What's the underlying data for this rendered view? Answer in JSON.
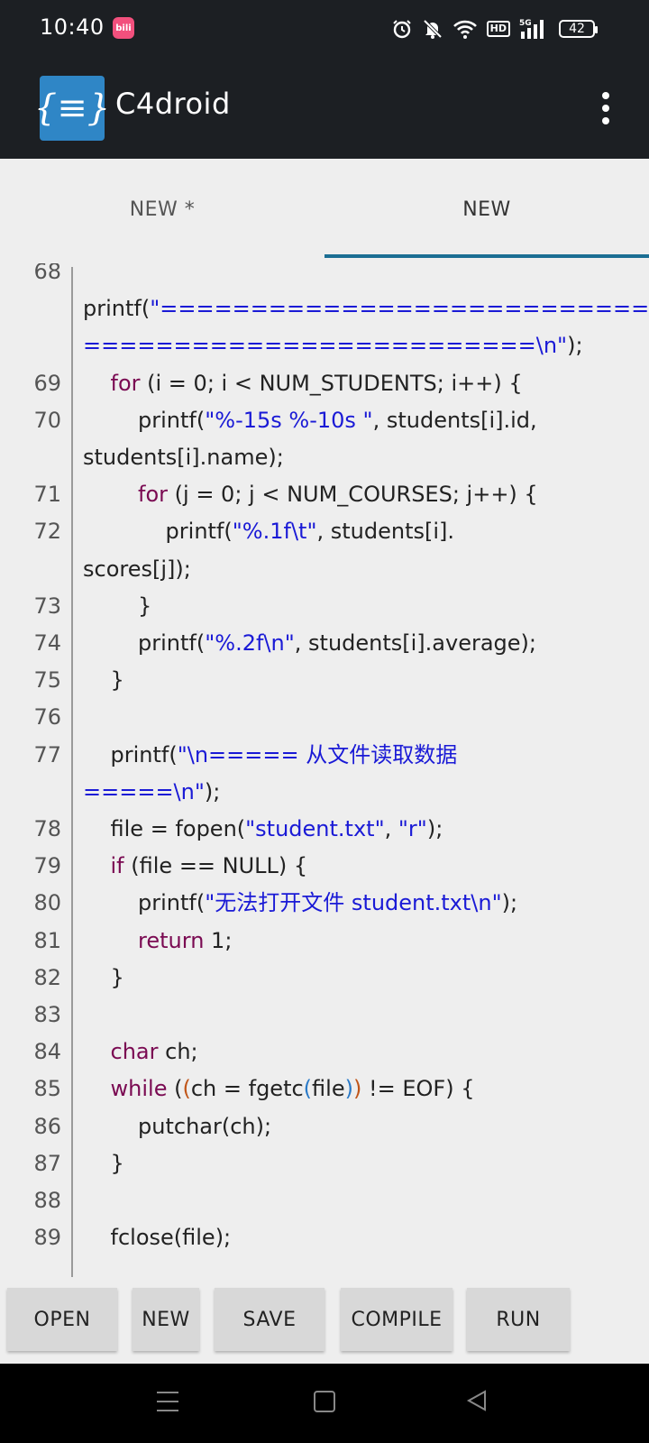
{
  "status_bar": {
    "time": "10:40",
    "app_notification": "bili",
    "battery": "42",
    "network_badge": "HD",
    "network_type": "5G"
  },
  "app_bar": {
    "title": "C4droid",
    "logo_glyph": "{≡}"
  },
  "tabs": [
    {
      "label": "NEW *",
      "active": false
    },
    {
      "label": "NEW",
      "active": true
    }
  ],
  "code_lines": [
    {
      "num": "68",
      "segments": []
    },
    {
      "num": "",
      "segments": [
        {
          "t": "printf(",
          "c": ""
        },
        {
          "t": "\"============================",
          "c": "st"
        }
      ]
    },
    {
      "num": "",
      "segments": [
        {
          "t": "=========================\\n\"",
          "c": "st"
        },
        {
          "t": ");",
          "c": ""
        }
      ]
    },
    {
      "num": "69",
      "segments": [
        {
          "t": "    ",
          "c": ""
        },
        {
          "t": "for",
          "c": "kw"
        },
        {
          "t": " (i = 0; i < NUM_STUDENTS; i++) {",
          "c": ""
        }
      ]
    },
    {
      "num": "70",
      "segments": [
        {
          "t": "        printf(",
          "c": ""
        },
        {
          "t": "\"%-15s %-10s \"",
          "c": "st"
        },
        {
          "t": ", students[i].id,",
          "c": ""
        }
      ]
    },
    {
      "num": "",
      "segments": [
        {
          "t": "students[i].name);",
          "c": ""
        }
      ]
    },
    {
      "num": "71",
      "segments": [
        {
          "t": "        ",
          "c": ""
        },
        {
          "t": "for",
          "c": "kw"
        },
        {
          "t": " (j = 0; j < NUM_COURSES; j++) {",
          "c": ""
        }
      ]
    },
    {
      "num": "72",
      "segments": [
        {
          "t": "            printf(",
          "c": ""
        },
        {
          "t": "\"%.1f\\t\"",
          "c": "st"
        },
        {
          "t": ", students[i].",
          "c": ""
        }
      ]
    },
    {
      "num": "",
      "segments": [
        {
          "t": "scores[j]);",
          "c": ""
        }
      ]
    },
    {
      "num": "73",
      "segments": [
        {
          "t": "        }",
          "c": ""
        }
      ]
    },
    {
      "num": "74",
      "segments": [
        {
          "t": "        printf(",
          "c": ""
        },
        {
          "t": "\"%.2f\\n\"",
          "c": "st"
        },
        {
          "t": ", students[i].average);",
          "c": ""
        }
      ]
    },
    {
      "num": "75",
      "segments": [
        {
          "t": "    }",
          "c": ""
        }
      ]
    },
    {
      "num": "76",
      "segments": []
    },
    {
      "num": "77",
      "segments": [
        {
          "t": "    printf(",
          "c": ""
        },
        {
          "t": "\"\\n===== 从文件读取数据",
          "c": "st"
        }
      ]
    },
    {
      "num": "",
      "segments": [
        {
          "t": "=====\\n\"",
          "c": "st"
        },
        {
          "t": ");",
          "c": ""
        }
      ]
    },
    {
      "num": "78",
      "segments": [
        {
          "t": "    file = fopen(",
          "c": ""
        },
        {
          "t": "\"student.txt\"",
          "c": "st"
        },
        {
          "t": ", ",
          "c": ""
        },
        {
          "t": "\"r\"",
          "c": "st"
        },
        {
          "t": ");",
          "c": ""
        }
      ]
    },
    {
      "num": "79",
      "segments": [
        {
          "t": "    ",
          "c": ""
        },
        {
          "t": "if",
          "c": "kw"
        },
        {
          "t": " (file == NULL) {",
          "c": ""
        }
      ]
    },
    {
      "num": "80",
      "segments": [
        {
          "t": "        printf(",
          "c": ""
        },
        {
          "t": "\"无法打开文件 student.txt\\n\"",
          "c": "st"
        },
        {
          "t": ");",
          "c": ""
        }
      ]
    },
    {
      "num": "81",
      "segments": [
        {
          "t": "        ",
          "c": ""
        },
        {
          "t": "return",
          "c": "kw"
        },
        {
          "t": " 1;",
          "c": ""
        }
      ]
    },
    {
      "num": "82",
      "segments": [
        {
          "t": "    }",
          "c": ""
        }
      ]
    },
    {
      "num": "83",
      "segments": []
    },
    {
      "num": "84",
      "segments": [
        {
          "t": "    ",
          "c": ""
        },
        {
          "t": "char",
          "c": "kw"
        },
        {
          "t": " ch;",
          "c": ""
        }
      ]
    },
    {
      "num": "85",
      "segments": [
        {
          "t": "    ",
          "c": ""
        },
        {
          "t": "while",
          "c": "kw"
        },
        {
          "t": " (",
          "c": ""
        },
        {
          "t": "(",
          "c": "pa"
        },
        {
          "t": "ch = fgetc",
          "c": ""
        },
        {
          "t": "(",
          "c": "pb"
        },
        {
          "t": "file",
          "c": ""
        },
        {
          "t": ")",
          "c": "pb"
        },
        {
          "t": ")",
          "c": "pa"
        },
        {
          "t": " != EOF) {",
          "c": ""
        }
      ]
    },
    {
      "num": "86",
      "segments": [
        {
          "t": "        putchar(ch);",
          "c": ""
        }
      ]
    },
    {
      "num": "87",
      "segments": [
        {
          "t": "    }",
          "c": ""
        }
      ]
    },
    {
      "num": "88",
      "segments": []
    },
    {
      "num": "89",
      "segments": [
        {
          "t": "    fclose(file);",
          "c": ""
        }
      ]
    }
  ],
  "toolbar": {
    "open_label": "OPEN",
    "new_label": "NEW",
    "save_label": "SAVE",
    "compile_label": "COMPILE",
    "run_label": "RUN"
  },
  "colors": {
    "keyword": "#7a0a52",
    "string": "#1a1ad6",
    "appbar": "#1c1f23",
    "tab_indicator": "#1b6e93"
  }
}
